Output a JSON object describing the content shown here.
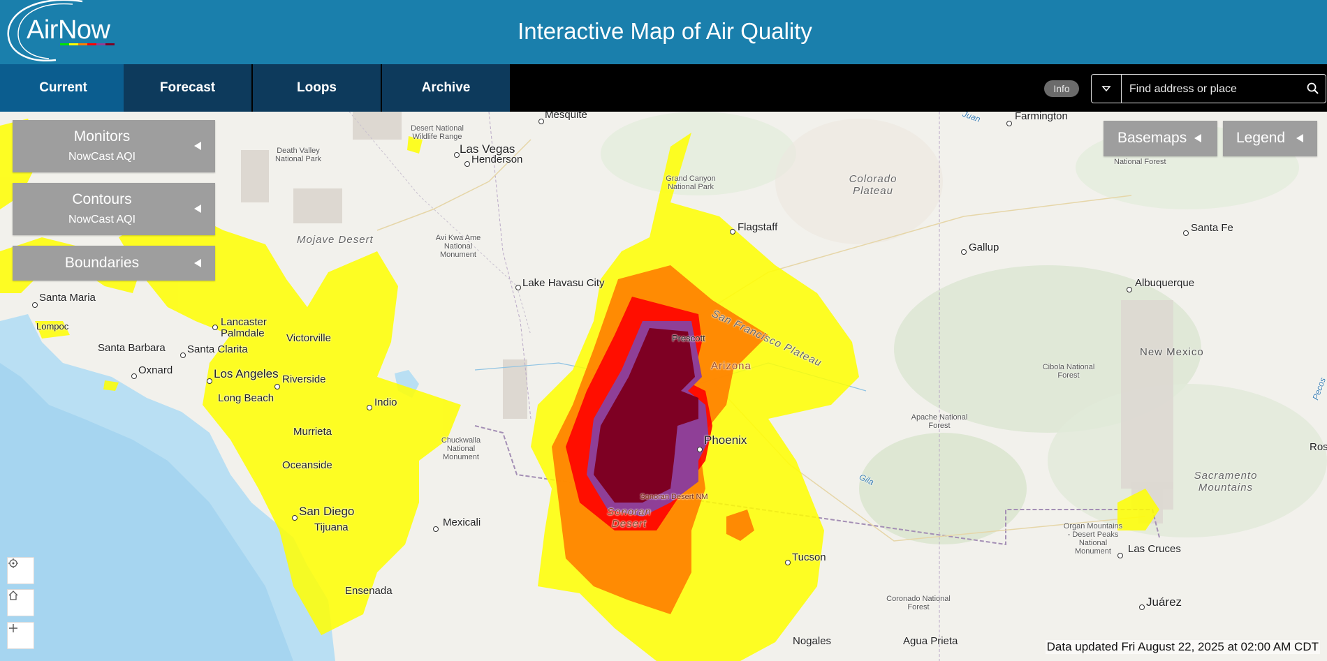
{
  "header": {
    "logo_text": "AirNow",
    "title": "Interactive Map of Air Quality",
    "logo_bar_colors": [
      "#00e400",
      "#ffff00",
      "#ff7e00",
      "#ff0000",
      "#8f3f97",
      "#7e0023"
    ]
  },
  "nav": {
    "tabs": [
      {
        "label": "Current",
        "active": true
      },
      {
        "label": "Forecast",
        "active": false
      },
      {
        "label": "Loops",
        "active": false
      },
      {
        "label": "Archive",
        "active": false
      }
    ],
    "info_label": "Info",
    "search": {
      "placeholder": "Find address or place",
      "icons": [
        "chevron-down-icon",
        "search-icon"
      ]
    }
  },
  "panels": {
    "monitors": {
      "title": "Monitors",
      "subtitle": "NowCast AQI"
    },
    "contours": {
      "title": "Contours",
      "subtitle": "NowCast AQI"
    },
    "boundaries": {
      "title": "Boundaries"
    }
  },
  "right_buttons": {
    "basemaps": "Basemaps",
    "legend": "Legend"
  },
  "map_controls": [
    "locate-icon",
    "home-icon",
    "zoom-in-icon"
  ],
  "status": {
    "data_updated": "Data updated Fri August 22, 2025 at 02:00 AM CDT"
  },
  "aqi_colors": {
    "moderate": "#ffff00",
    "usg": "#ff7e00",
    "unhealthy": "#ff0000",
    "very_unhealthy": "#8f3f97",
    "hazardous": "#7e0023"
  },
  "map": {
    "cities": [
      "Mesquite",
      "Las Vegas",
      "Henderson",
      "Lake Havasu City",
      "Flagstaff",
      "Prescott",
      "Phoenix",
      "Tucson",
      "Nogales",
      "Farmington",
      "Gallup",
      "Santa Fe",
      "Albuquerque",
      "Las Cruces",
      "Juárez",
      "Agua Prieta",
      "Santa Maria",
      "Lompoc",
      "Santa Barbara",
      "Oxnard",
      "Lancaster",
      "Palmdale",
      "Santa Clarita",
      "Victorville",
      "Los Angeles",
      "Riverside",
      "Long Beach",
      "Indio",
      "Murrieta",
      "Oceanside",
      "San Diego",
      "Tijuana",
      "Mexicali",
      "Ensenada",
      "Rosweı"
    ],
    "regions": [
      "Mojave Desert",
      "Colorado Plateau",
      "San Francisco Plateau",
      "Sonoran Desert",
      "Sacramento Mountains",
      "Arizona",
      "New Mexico"
    ],
    "parks": [
      "Death Valley National Park",
      "Desert National Wildlife Range",
      "Grand Canyon National Park",
      "Avi Kwa Ame National Monument",
      "Chuckwalla National Monument",
      "Cibola National Forest",
      "Apache National Forest",
      "Organ Mountains - Desert Peaks National Monument",
      "Coronado National Forest",
      "Sonoran Desert NM",
      "National Forest"
    ],
    "water": [
      "Gila",
      "Juan",
      "Pecos"
    ]
  }
}
